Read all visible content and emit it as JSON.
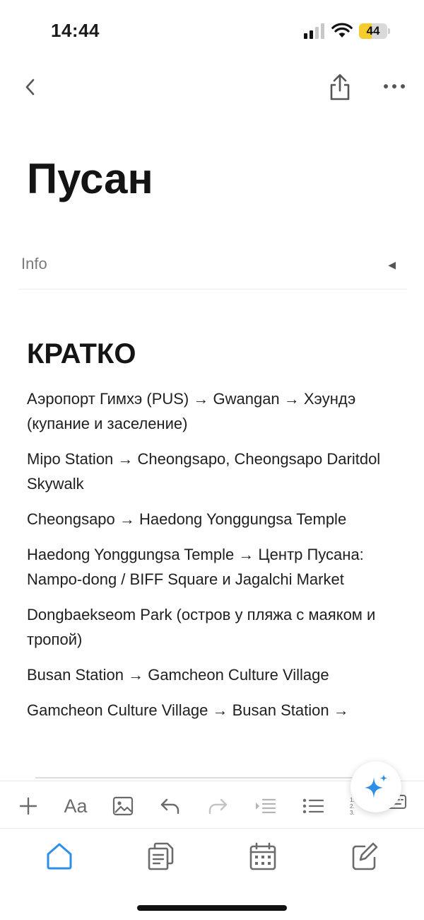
{
  "status_bar": {
    "time": "14:44",
    "battery": "44",
    "battery_level": 0.44
  },
  "page": {
    "title": "Пусан",
    "info_label": "Info",
    "heading": "КРАТКО",
    "items": [
      "Аэропорт Гимхэ (PUS) → Gwangan → Хэундэ (купание и заселение)",
      "Mipo Station → Cheongsapo, Cheongsapo Daritdol Skywalk",
      "Cheongsapo → Haedong Yonggungsa Temple",
      "Haedong Yonggungsa Temple → Центр Пусана: Nampo-dong / BIFF Square и Jagalchi Market",
      "Dongbaekseom Park (остров у пляжа с маяком и тропой)",
      "Busan Station → Gamcheon Culture Village",
      "Gamcheon Culture Village → Busan Station →"
    ]
  },
  "toolbar": {
    "text_format_label": "Aa"
  },
  "icons": {
    "nav": [
      "back-icon",
      "share-icon",
      "more-icon"
    ],
    "toolbar": [
      "plus-icon",
      "text-format-icon",
      "image-icon",
      "undo-icon",
      "redo-icon",
      "indent-icon",
      "bulleted-list-icon",
      "numbered-list-icon",
      "keyboard-icon"
    ],
    "tabs": [
      "home-icon",
      "documents-icon",
      "calendar-icon",
      "compose-icon"
    ],
    "fab": "ai-sparkle-icon"
  },
  "colors": {
    "accent": "#2d8ee8",
    "battery_fill": "#f6cc2c",
    "icon_gray": "#6b6b6b"
  }
}
